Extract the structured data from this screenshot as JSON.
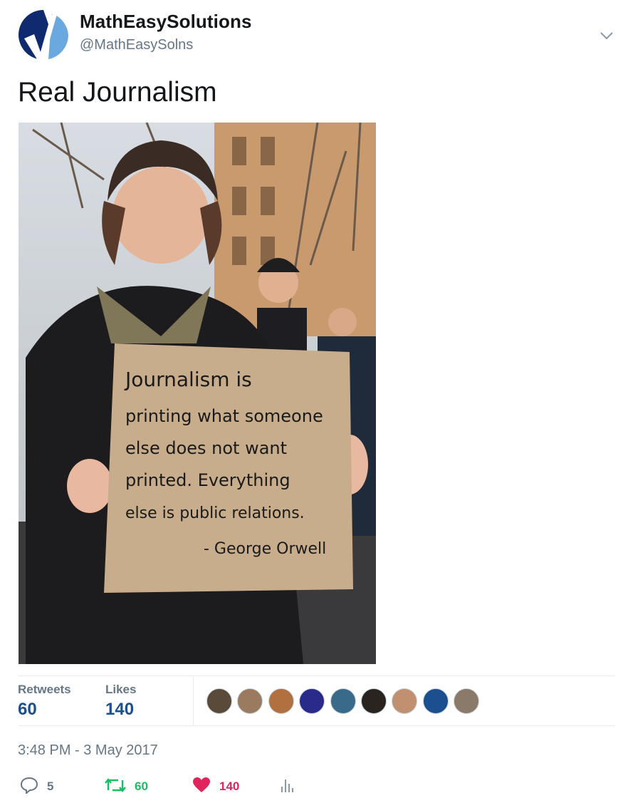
{
  "tweet": {
    "display_name": "MathEasySolutions",
    "handle": "@MathEasySolns",
    "text": "Real Journalism",
    "sign_text": [
      "Journalism is",
      "printing what someone",
      "else does not want",
      "printed. Everything",
      "else is public relations.",
      "- George Orwell"
    ]
  },
  "stats": {
    "retweets_label": "Retweets",
    "retweets_value": "60",
    "likes_label": "Likes",
    "likes_value": "140"
  },
  "likers": [
    {
      "name": "liker-avatar-1",
      "color": "#5a4a3a"
    },
    {
      "name": "liker-avatar-2",
      "color": "#9a7b5f"
    },
    {
      "name": "liker-avatar-3",
      "color": "#b07040"
    },
    {
      "name": "liker-avatar-4",
      "color": "#2a2a8a"
    },
    {
      "name": "liker-avatar-5",
      "color": "#3a6a8a"
    },
    {
      "name": "liker-avatar-6",
      "color": "#2a2420"
    },
    {
      "name": "liker-avatar-7",
      "color": "#c09070"
    },
    {
      "name": "liker-avatar-8",
      "color": "#1c4f8f"
    },
    {
      "name": "liker-avatar-9",
      "color": "#8a7a6a"
    }
  ],
  "timestamp": "3:48 PM - 3 May 2017",
  "actions": {
    "reply_count": "5",
    "retweet_count": "60",
    "like_count": "140"
  },
  "colors": {
    "brand_blue": "#1c4f8f",
    "retweet_green": "#17bf63",
    "like_red": "#e0245e",
    "muted": "#657786"
  }
}
